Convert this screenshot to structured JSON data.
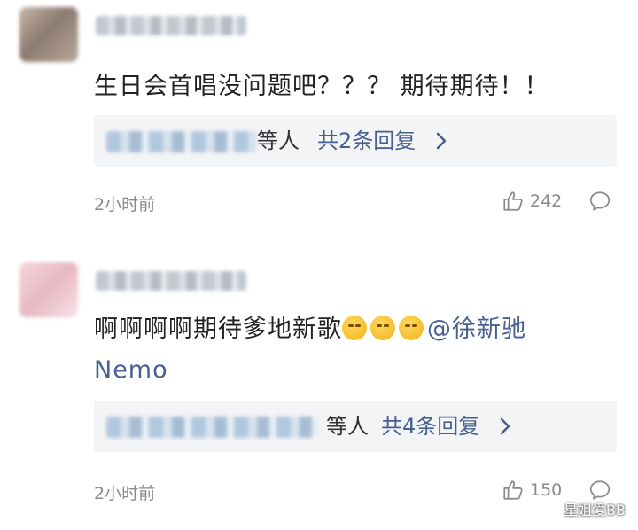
{
  "comments": [
    {
      "text": "生日会首唱没问题吧？？？ 期待期待！！",
      "replies": {
        "who": "等人",
        "count_text": "共2条回复"
      },
      "time": "2小时前",
      "likes": "242"
    },
    {
      "text_prefix": "啊啊啊啊期待爹地新歌",
      "emojis": [
        "grimace-emoji",
        "grimace-emoji",
        "grimace-emoji"
      ],
      "mention": "@徐新驰",
      "mention_line2": "Nemo",
      "replies": {
        "who": "等人",
        "count_text": "共4条回复"
      },
      "time": "2小时前",
      "likes": "150"
    }
  ],
  "watermark": "星姐爱BB",
  "colors": {
    "mention": "#47608f",
    "reply_bg": "#f3f4f6",
    "meta": "#8a8a8a"
  }
}
